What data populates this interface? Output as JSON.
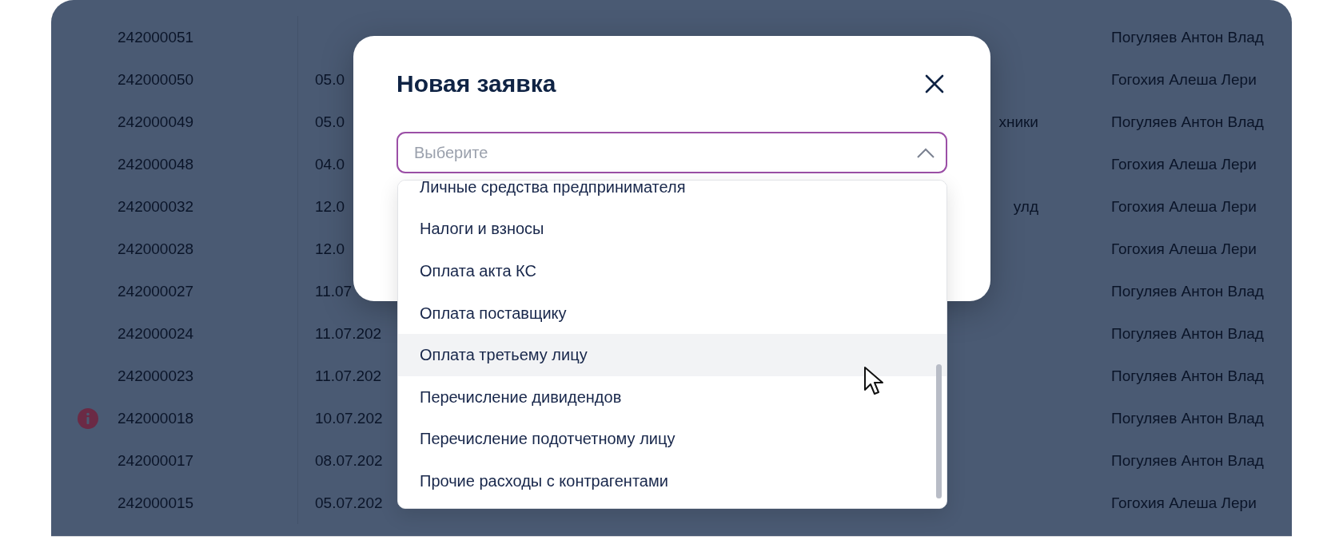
{
  "table": {
    "rows": [
      {
        "alert": false,
        "id": "242000051",
        "person": "Погуляев Антон Влад"
      },
      {
        "alert": false,
        "id": "242000050",
        "date": "05.0",
        "person": "Гогохия Алеша Лери"
      },
      {
        "alert": false,
        "id": "242000049",
        "date": "05.0",
        "purpose": {
          "text": "хники",
          "cut": true
        },
        "person": "Погуляев Антон Влад"
      },
      {
        "alert": false,
        "id": "242000048",
        "date": "04.0",
        "person": "Гогохия Алеша Лери"
      },
      {
        "alert": false,
        "id": "242000032",
        "date": "12.0",
        "purpose": {
          "text": "улд",
          "cut": true
        },
        "person": "Гогохия Алеша Лери"
      },
      {
        "alert": false,
        "id": "242000028",
        "date": "12.0",
        "person": "Гогохия Алеша Лери"
      },
      {
        "alert": false,
        "id": "242000027",
        "date": "11.07",
        "person": "Погуляев Антон Влад"
      },
      {
        "alert": false,
        "id": "242000024",
        "date": "11.07.202",
        "person": "Погуляев Антон Влад"
      },
      {
        "alert": false,
        "id": "242000023",
        "date": "11.07.202",
        "person": "Погуляев Антон Влад"
      },
      {
        "alert": true,
        "id": "242000018",
        "date": "10.07.202",
        "person": "Погуляев Антон Влад"
      },
      {
        "alert": false,
        "id": "242000017",
        "date": "08.07.202",
        "person": "Погуляев Антон Влад"
      },
      {
        "alert": false,
        "id": "242000015",
        "date": "05.07.202",
        "person": "Гогохия Алеша Лери"
      }
    ]
  },
  "modal": {
    "title": "Новая заявка",
    "select": {
      "placeholder": "Выберите",
      "expanded": true
    },
    "options": [
      {
        "label": "Личные средства предпринимателя",
        "hovered": false
      },
      {
        "label": "Налоги и взносы",
        "hovered": false
      },
      {
        "label": "Оплата акта КС",
        "hovered": false
      },
      {
        "label": "Оплата поставщику",
        "hovered": false
      },
      {
        "label": "Оплата третьему лицу",
        "hovered": true
      },
      {
        "label": "Перечисление дивидендов",
        "hovered": false
      },
      {
        "label": "Перечисление подотчетному лицу",
        "hovered": false
      },
      {
        "label": "Прочие расходы с контрагентами",
        "hovered": false
      }
    ]
  }
}
